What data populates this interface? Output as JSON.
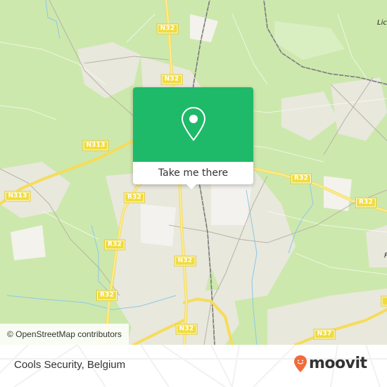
{
  "map": {
    "road_labels": [
      {
        "id": "n32-top",
        "text": "N32"
      },
      {
        "id": "n32-upper",
        "text": "N32"
      },
      {
        "id": "n313-left",
        "text": "N313"
      },
      {
        "id": "n313-far-left",
        "text": "N313"
      },
      {
        "id": "r32-center",
        "text": "R32"
      },
      {
        "id": "r32-right",
        "text": "R32"
      },
      {
        "id": "r32-far-right",
        "text": "R32"
      },
      {
        "id": "r32-left-mid",
        "text": "R32"
      },
      {
        "id": "r32-left-low",
        "text": "R32"
      },
      {
        "id": "n32-mid",
        "text": "N32"
      },
      {
        "id": "n32-bottom",
        "text": "N32"
      },
      {
        "id": "n37",
        "text": "N37"
      }
    ],
    "place_labels": [
      {
        "id": "lic",
        "text": "Lic"
      },
      {
        "id": "p-right",
        "text": "P"
      }
    ],
    "attribution": "© OpenStreetMap contributors"
  },
  "popup": {
    "icon": "map-pin-icon",
    "button_label": "Take me there",
    "color": "#1fb96a"
  },
  "footer": {
    "title": "Cools Security, Belgium",
    "logo_text": "moovit",
    "logo_color": "#f26b3a"
  }
}
